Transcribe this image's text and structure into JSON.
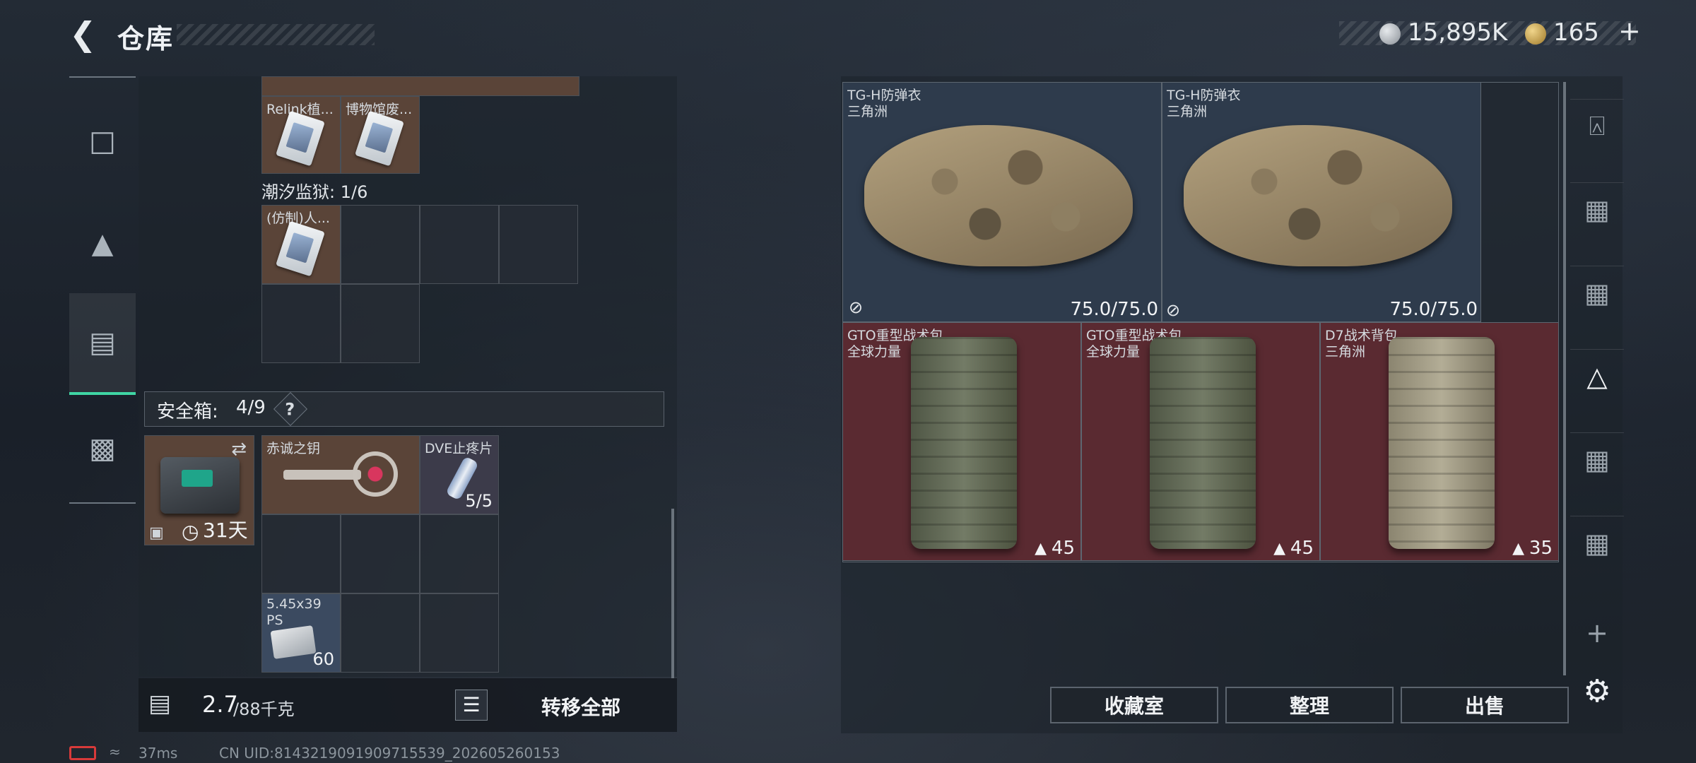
{
  "header": {
    "title": "仓库",
    "back_icon": "back-arrow-icon"
  },
  "currency": {
    "silver": "15,895K",
    "gold": "165",
    "plus": "+"
  },
  "left_nav": {
    "icons": [
      "pistol-icon",
      "armor-icon",
      "backpack-icon",
      "briefcase-icon"
    ]
  },
  "storage": {
    "top_items": [
      "Relink植...",
      "博物馆废..."
    ],
    "prison_label": "潮汐监狱: 1/6",
    "prison_item": "(仿制)人...",
    "safe_label": "安全箱:",
    "safe_count": "4/9",
    "safe_help": "?",
    "safe_days": "31天",
    "key_name": "赤诚之钥",
    "pill_name": "DVE止疼片",
    "pill_count": "5/5",
    "ammo_name": "5.45x39",
    "ammo_sub": "PS",
    "ammo_count": "60"
  },
  "footer": {
    "weight_value": "2.7",
    "weight_capacity": "/88千克",
    "transfer_all": "转移全部"
  },
  "vests": [
    {
      "name": "TG-H防弹衣",
      "maker": "三角洲",
      "durability": "75.0/75.0"
    },
    {
      "name": "TG-H防弹衣",
      "maker": "三角洲",
      "durability": "75.0/75.0"
    }
  ],
  "packs": [
    {
      "name": "GTO重型战术包",
      "maker": "全球力量",
      "weight": "45"
    },
    {
      "name": "GTO重型战术包",
      "maker": "全球力量",
      "weight": "45"
    },
    {
      "name": "D7战术背包",
      "maker": "三角洲",
      "weight": "35"
    }
  ],
  "buttons": {
    "collection": "收藏室",
    "organize": "整理",
    "sell": "出售"
  },
  "right_nav": {
    "plus": "+",
    "settings_icon": "gear-icon"
  },
  "status": {
    "ping": "37ms",
    "uid": "CN UID:8143219091909715539_202605260153"
  },
  "colors": {
    "accent": "#3fd6a4",
    "red_cell": "#5a2a31",
    "blue_cell": "#2e3b4c"
  }
}
